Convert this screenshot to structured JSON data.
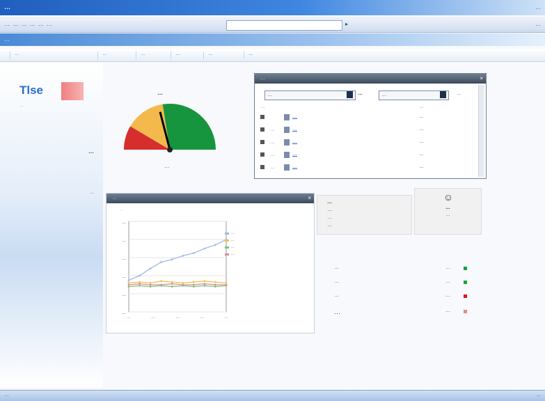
{
  "window": {
    "title": "…",
    "top_right": "…"
  },
  "toolbar": {
    "buttons_text": "… … … … … …",
    "address": "",
    "go": "▸",
    "right_text": "…"
  },
  "band": {
    "label": "…"
  },
  "nav": {
    "tabs": [
      "…",
      "…",
      "…",
      "…",
      "…",
      "…"
    ]
  },
  "brand": {
    "logo_text": "Tlse",
    "tagline": "…"
  },
  "sidebar": {
    "heading": "…",
    "body": "…"
  },
  "gauge": {
    "title": "…",
    "value_label": "…",
    "value_fraction": 0.42,
    "colors": {
      "red": "#d62d2d",
      "yellow": "#f4b94c",
      "green": "#16943e"
    }
  },
  "alerts": {
    "title": "…",
    "filter": {
      "select1": "…",
      "label": "…",
      "select2": "…",
      "button": "…"
    },
    "columns": {
      "name": "…",
      "date": "…"
    },
    "rows": [
      {
        "sev": "",
        "text": "…",
        "date": "…"
      },
      {
        "sev": "…",
        "text": "…",
        "date": "…"
      },
      {
        "sev": "…",
        "text": "…",
        "date": "…"
      },
      {
        "sev": "…",
        "text": "…",
        "date": "…"
      },
      {
        "sev": "…",
        "text": "…",
        "date": "…"
      }
    ]
  },
  "chart_panel": {
    "title": "…",
    "subtitle": "…"
  },
  "chart_data": {
    "type": "line",
    "title": "",
    "xlabel": "",
    "ylabel": "",
    "y_ticks": [
      "…",
      "…",
      "…",
      "…",
      "…",
      "…"
    ],
    "x_ticks": [
      "…",
      "…",
      "…",
      "…",
      "…"
    ],
    "x": [
      1,
      2,
      3,
      4,
      5,
      6,
      7,
      8,
      9,
      10
    ],
    "ylim": [
      0,
      100
    ],
    "series": [
      {
        "color": "#9fb9e6",
        "values": [
          35,
          40,
          48,
          55,
          58,
          62,
          65,
          70,
          74,
          80
        ]
      },
      {
        "color": "#f2c14e",
        "values": [
          32,
          33,
          32,
          34,
          33,
          32,
          33,
          34,
          33,
          32
        ]
      },
      {
        "color": "#7bc47b",
        "values": [
          28,
          29,
          28,
          29,
          28,
          29,
          28,
          29,
          28,
          29
        ]
      },
      {
        "color": "#e28aa0",
        "values": [
          30,
          31,
          30,
          30,
          31,
          30,
          30,
          31,
          30,
          30
        ]
      }
    ],
    "legend": [
      "…",
      "…",
      "…",
      "…"
    ],
    "grid": true,
    "legend_position": "right"
  },
  "quick": {
    "items": [
      "…",
      "…",
      "…",
      "…"
    ]
  },
  "help": {
    "icon": "person-help-icon",
    "title": "…",
    "text": "…"
  },
  "stats": [
    {
      "label": "…",
      "value": "…",
      "color": "#1aa33a"
    },
    {
      "label": "…",
      "value": "…",
      "color": "#1aa33a"
    },
    {
      "label": "…",
      "value": "…",
      "color": "#d81b1b"
    },
    {
      "label": "…",
      "value": "…",
      "color": "#e58a8a"
    }
  ],
  "status": {
    "left": "…",
    "right": "…"
  }
}
